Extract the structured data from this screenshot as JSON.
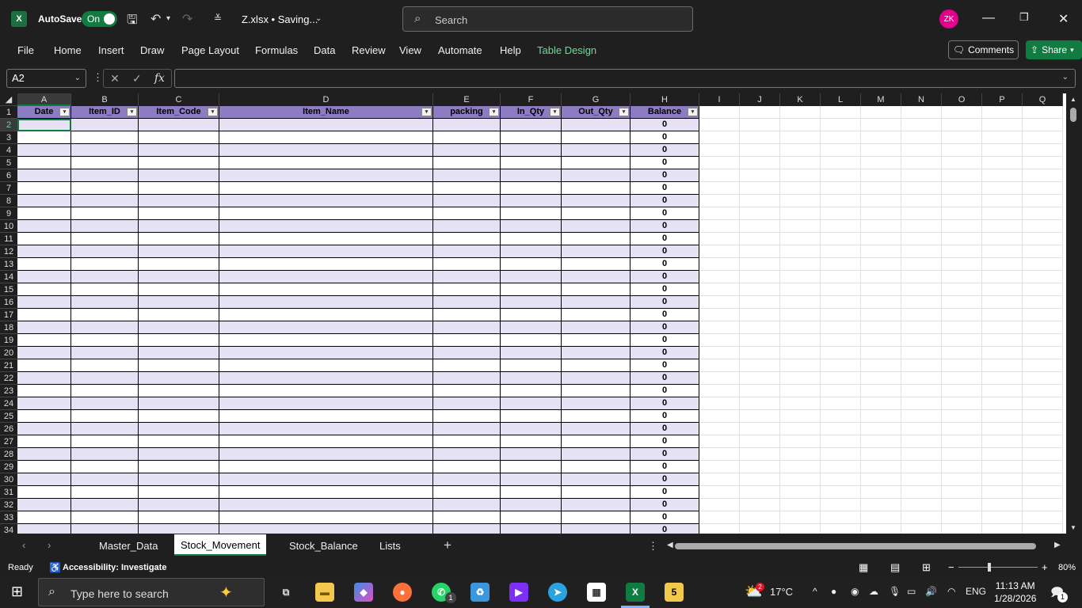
{
  "titlebar": {
    "app_logo": "X",
    "autosave_label": "AutoSave",
    "autosave_state": "On",
    "filename": "Z.xlsx • Saving...",
    "search_placeholder": "Search",
    "avatar_initials": "ZK"
  },
  "ribbon": {
    "menus": [
      "File",
      "Home",
      "Insert",
      "Draw",
      "Page Layout",
      "Formulas",
      "Data",
      "Review",
      "View",
      "Automate",
      "Help",
      "Table Design"
    ],
    "comments_label": "Comments",
    "share_label": "Share"
  },
  "formula_bar": {
    "name_box": "A2",
    "fx": "fx",
    "formula": ""
  },
  "grid": {
    "columns": [
      "A",
      "B",
      "C",
      "D",
      "E",
      "F",
      "G",
      "H",
      "I",
      "J",
      "K",
      "L",
      "M",
      "N",
      "O",
      "P",
      "Q"
    ],
    "table_headers": [
      "Date",
      "Item_ID",
      "Item_Code",
      "Item_Name",
      "packing",
      "In_Qty",
      "Out_Qty",
      "Balance"
    ],
    "rows": [
      1,
      2,
      3,
      4,
      5,
      6,
      7,
      8,
      9,
      10,
      11,
      12,
      13,
      14,
      15,
      16,
      17,
      18,
      19,
      20,
      21,
      22,
      23,
      24,
      25,
      26,
      27,
      28,
      29,
      30,
      31,
      32,
      33,
      34
    ],
    "balance_value": "0",
    "selected_cell": "A2"
  },
  "sheet_tabs": {
    "tabs": [
      "Master_Data",
      "Stock_Movement",
      "Stock_Balance",
      "Lists"
    ],
    "active": "Stock_Movement"
  },
  "status": {
    "ready": "Ready",
    "accessibility": "Accessibility: Investigate",
    "zoom": "80%"
  },
  "taskbar": {
    "search_placeholder": "Type here to search",
    "weather_temp": "17°C",
    "language": "ENG",
    "time": "11:13 AM",
    "date": "1/28/2026",
    "notification_count": "1",
    "whatsapp_badge": "1",
    "weather_badge": "2"
  },
  "colors": {
    "excel_green": "#107c41",
    "table_header": "#8e7cc3",
    "table_band": "#e6e2f3"
  }
}
